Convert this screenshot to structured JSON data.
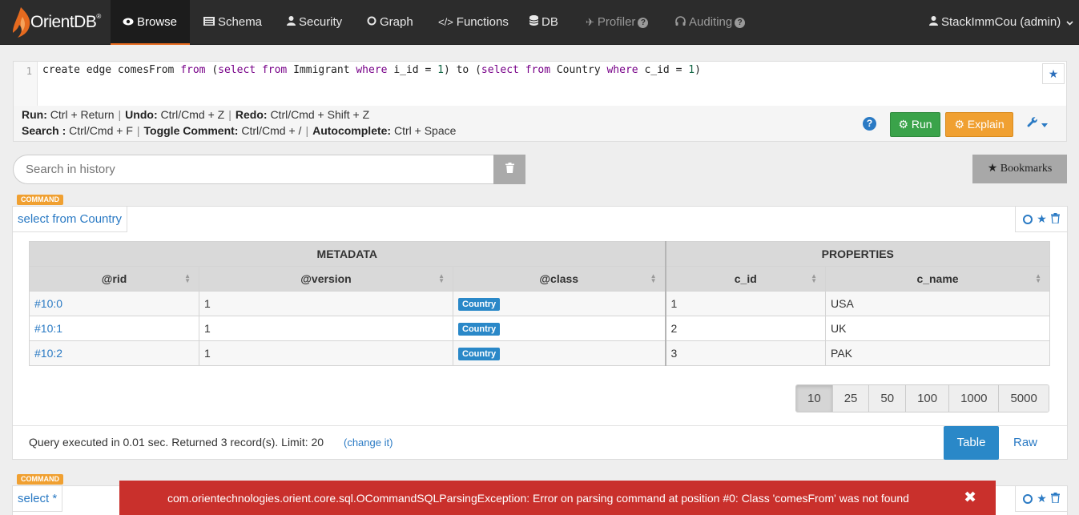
{
  "app": {
    "brand": "OrientDB",
    "brand_mark": "®",
    "colors": {
      "navbar": "#2c2c2c",
      "accent": "#e56a1f",
      "primary": "#2a7ac4",
      "success": "#3aa34a",
      "warning": "#f0a031",
      "danger": "#c9302c"
    }
  },
  "nav": {
    "items": [
      {
        "label": "Browse",
        "icon": "eye-icon",
        "active": true
      },
      {
        "label": "Schema",
        "icon": "table-icon"
      },
      {
        "label": "Security",
        "icon": "user-icon"
      },
      {
        "label": "Graph",
        "icon": "circle-icon"
      },
      {
        "label": "Functions",
        "icon": "code-icon"
      },
      {
        "label": "DB",
        "icon": "database-icon"
      },
      {
        "label": "Profiler",
        "icon": "plane-icon",
        "disabled": true
      },
      {
        "label": "Auditing",
        "icon": "headphones-icon",
        "disabled": true
      }
    ],
    "user": "StackImmCou (admin)"
  },
  "editor": {
    "line_number": "1",
    "tokens": [
      "create edge comesFrom ",
      "from",
      " (",
      "select",
      " ",
      "from",
      " Immigrant ",
      "where",
      " i_id = ",
      "1",
      ") ",
      "to",
      " (",
      "select",
      " ",
      "from",
      " Country ",
      "where",
      " c_id = ",
      "1",
      ")"
    ]
  },
  "shortcuts": {
    "line1": [
      {
        "k": "Run:",
        "v": "Ctrl + Return"
      },
      {
        "k": "Undo:",
        "v": "Ctrl/Cmd + Z"
      },
      {
        "k": "Redo:",
        "v": "Ctrl/Cmd + Shift + Z"
      }
    ],
    "line2": [
      {
        "k": "Search :",
        "v": "Ctrl/Cmd + F"
      },
      {
        "k": "Toggle Comment:",
        "v": "Ctrl/Cmd + /"
      },
      {
        "k": "Autocomplete:",
        "v": "Ctrl + Space"
      }
    ],
    "run_label": "Run",
    "explain_label": "Explain"
  },
  "history": {
    "placeholder": "Search in history",
    "bookmarks_label": "Bookmarks"
  },
  "panel1": {
    "badge": "COMMAND",
    "title": "select from Country",
    "group_headers": [
      "METADATA",
      "PROPERTIES"
    ],
    "columns": [
      "@rid",
      "@version",
      "@class",
      "c_id",
      "c_name"
    ],
    "rows": [
      {
        "rid": "#10:0",
        "version": "1",
        "class": "Country",
        "c_id": "1",
        "c_name": "USA"
      },
      {
        "rid": "#10:1",
        "version": "1",
        "class": "Country",
        "c_id": "2",
        "c_name": "UK"
      },
      {
        "rid": "#10:2",
        "version": "1",
        "class": "Country",
        "c_id": "3",
        "c_name": "PAK"
      }
    ],
    "page_sizes": [
      "10",
      "25",
      "50",
      "100",
      "1000",
      "5000"
    ],
    "current_page_size": "10",
    "query_info": "Query executed in 0.01 sec. Returned 3 record(s). Limit: 20",
    "change_link": "(change it)",
    "view_table": "Table",
    "view_raw": "Raw"
  },
  "panel2": {
    "badge": "COMMAND",
    "title": "select *"
  },
  "error": {
    "message": "com.orientechnologies.orient.core.sql.OCommandSQLParsingException: Error on parsing command at position #0: Class 'comesFrom' was not found",
    "close": "✖"
  }
}
